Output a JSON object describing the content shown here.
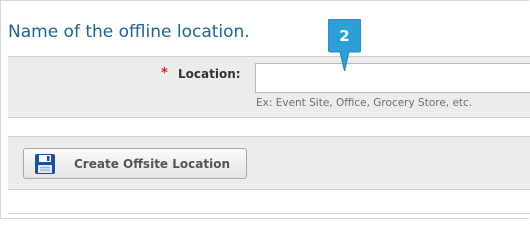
{
  "section": {
    "title": "Name of the offline location."
  },
  "location_field": {
    "required_mark": "*",
    "label": "Location:",
    "value": "",
    "placeholder": "",
    "hint": "Ex: Event Site, Office, Grocery Store, etc."
  },
  "callout": {
    "step": "2"
  },
  "actions": {
    "create_label": "Create Offsite Location",
    "icon": "floppy-disk-save-icon"
  },
  "colors": {
    "title": "#1f6296",
    "callout": "#2d9fd8",
    "required": "#d81e1e",
    "save_icon": "#1d4f9c"
  }
}
